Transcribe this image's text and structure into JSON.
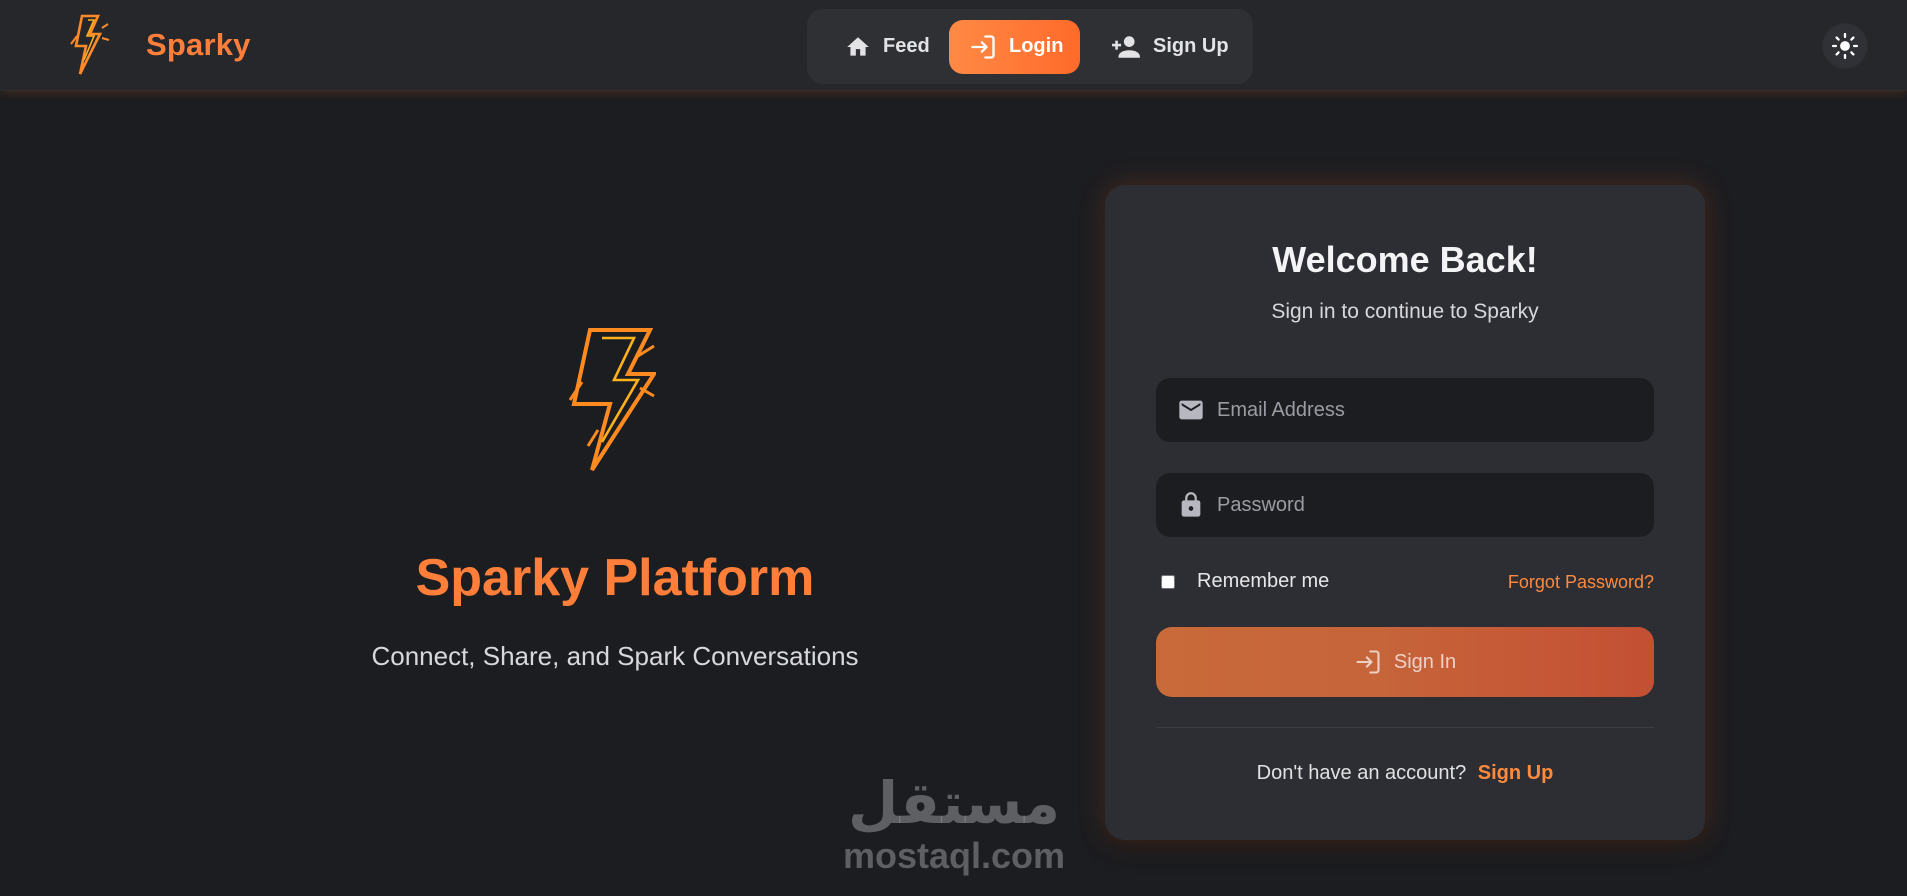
{
  "brand": {
    "name": "Sparky",
    "logo_icon": "lightning-bolt-icon",
    "accent": "#ff7f3a"
  },
  "nav": {
    "items": [
      {
        "label": "Feed",
        "icon": "home-icon"
      },
      {
        "label": "Login",
        "icon": "login-icon",
        "active": true
      },
      {
        "label": "Sign Up",
        "icon": "person-add-icon"
      }
    ]
  },
  "theme_toggle": {
    "icon": "sun-icon"
  },
  "hero": {
    "title": "Sparky Platform",
    "subtitle": "Connect, Share, and Spark Conversations"
  },
  "login": {
    "title": "Welcome Back!",
    "subtitle": "Sign in to continue to Sparky",
    "email": {
      "placeholder": "Email Address",
      "value": "",
      "icon": "mail-icon"
    },
    "password": {
      "placeholder": "Password",
      "value": "",
      "icon": "lock-icon"
    },
    "remember_label": "Remember me",
    "remember_checked": false,
    "forgot_label": "Forgot Password?",
    "submit_label": "Sign In",
    "no_account_text": "Don't have an account?",
    "signup_link": "Sign Up"
  },
  "watermark": {
    "arabic": "مستقل",
    "latin": "mostaql.com"
  },
  "colors": {
    "background": "#1c1d21",
    "card": "#2d2e33",
    "accent": "#ff7f3a",
    "button_gradient_end": "#c44f33"
  }
}
